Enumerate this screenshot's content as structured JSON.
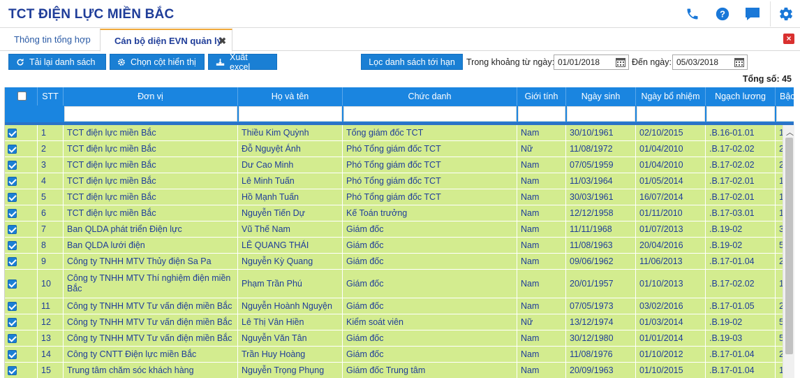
{
  "header": {
    "title": "TCT ĐIỆN LỰC MIỀN BẮC",
    "icons": [
      "phone-icon",
      "help-icon",
      "chat-icon",
      "settings-icon"
    ],
    "accent": "#1a78d8"
  },
  "tabs": [
    {
      "label": "Thông tin tổng hợp",
      "active": false
    },
    {
      "label": "Cán bộ diện EVN quản lý",
      "active": true,
      "close": "✖"
    }
  ],
  "toolbar": {
    "reload_label": "Tải lại danh sách",
    "columns_label": "Chọn cột hiển thị",
    "export_label": "Xuất excel",
    "filter_due_label": "Lọc danh sách tới hạn",
    "from_label": "Trong khoảng từ ngày:",
    "from_value": "01/01/2018",
    "to_label": "Đến ngày:",
    "to_value": "05/03/2018",
    "total_label": "Tổng số: 45"
  },
  "table": {
    "headers": [
      "",
      "STT",
      "Đơn vị",
      "Họ và tên",
      "Chức danh",
      "Giới tính",
      "Ngày sinh",
      "Ngày bổ nhiệm",
      "Ngạch lương",
      "Bậc"
    ],
    "rows": [
      {
        "stt": "1",
        "unit": "TCT điện lực miền Bắc",
        "name": "Thiều Kim Quỳnh",
        "title": "Tổng giám đốc TCT",
        "gender": "Nam",
        "dob": "30/10/1961",
        "appointed": "02/10/2015",
        "grade": ".B.16-01.01",
        "level": "1"
      },
      {
        "stt": "2",
        "unit": "TCT điện lực miền Bắc",
        "name": "Đỗ Nguyệt Ánh",
        "title": "Phó Tổng giám đốc TCT",
        "gender": "Nữ",
        "dob": "11/08/1972",
        "appointed": "01/04/2010",
        "grade": ".B.17-02.02",
        "level": "2"
      },
      {
        "stt": "3",
        "unit": "TCT điện lực miền Bắc",
        "name": "Dư Cao Minh",
        "title": "Phó Tổng giám đốc TCT",
        "gender": "Nam",
        "dob": "07/05/1959",
        "appointed": "01/04/2010",
        "grade": ".B.17-02.02",
        "level": "2"
      },
      {
        "stt": "4",
        "unit": "TCT điện lực miền Bắc",
        "name": "Lê Minh Tuấn",
        "title": "Phó Tổng giám đốc TCT",
        "gender": "Nam",
        "dob": "11/03/1964",
        "appointed": "01/05/2014",
        "grade": ".B.17-02.01",
        "level": "1"
      },
      {
        "stt": "5",
        "unit": "TCT điện lực miền Bắc",
        "name": "Hồ Mạnh Tuấn",
        "title": "Phó Tổng giám đốc TCT",
        "gender": "Nam",
        "dob": "30/03/1961",
        "appointed": "16/07/2014",
        "grade": ".B.17-02.01",
        "level": "1"
      },
      {
        "stt": "6",
        "unit": "TCT điện lực miền Bắc",
        "name": "Nguyễn Tiến Dự",
        "title": "Kế Toán trưởng",
        "gender": "Nam",
        "dob": "12/12/1958",
        "appointed": "01/11/2010",
        "grade": ".B.17-03.01",
        "level": "1"
      },
      {
        "stt": "7",
        "unit": "Ban QLDA phát triển Điện lực",
        "name": "Vũ Thế Nam",
        "title": "Giám đốc",
        "gender": "Nam",
        "dob": "11/11/1968",
        "appointed": "01/07/2013",
        "grade": ".B.19-02",
        "level": "3"
      },
      {
        "stt": "8",
        "unit": "Ban QLDA lưới điện",
        "name": "LÊ QUANG THÁI",
        "title": "Giám đốc",
        "gender": "Nam",
        "dob": "11/08/1963",
        "appointed": "20/04/2016",
        "grade": ".B.19-02",
        "level": "5"
      },
      {
        "stt": "9",
        "unit": "Công ty TNHH MTV Thủy điện Sa Pa",
        "name": "Nguyễn Kỳ Quang",
        "title": "Giám đốc",
        "gender": "Nam",
        "dob": "09/06/1962",
        "appointed": "11/06/2013",
        "grade": ".B.17-01.04",
        "level": "2"
      },
      {
        "stt": "10",
        "unit": "Công ty TNHH MTV Thí nghiệm điện miền Bắc",
        "name": "Phạm Trần Phú",
        "title": "Giám đốc",
        "gender": "Nam",
        "dob": "20/01/1957",
        "appointed": "01/10/2013",
        "grade": ".B.17-02.02",
        "level": "1"
      },
      {
        "stt": "11",
        "unit": "Công ty TNHH MTV Tư vấn điện miền Bắc",
        "name": "Nguyễn Hoành Nguyện",
        "title": "Giám đốc",
        "gender": "Nam",
        "dob": "07/05/1973",
        "appointed": "03/02/2016",
        "grade": ".B.17-01.05",
        "level": "2"
      },
      {
        "stt": "12",
        "unit": "Công ty TNHH MTV Tư vấn điện miền Bắc",
        "name": "Lê Thị Vân Hiền",
        "title": "Kiểm soát viên",
        "gender": "Nữ",
        "dob": "13/12/1974",
        "appointed": "01/03/2014",
        "grade": ".B.19-02",
        "level": "5"
      },
      {
        "stt": "13",
        "unit": "Công ty TNHH MTV Tư vấn điện miền Bắc",
        "name": "Nguyễn Văn Tân",
        "title": "Giám đốc",
        "gender": "Nam",
        "dob": "30/12/1980",
        "appointed": "01/01/2014",
        "grade": ".B.19-03",
        "level": "5"
      },
      {
        "stt": "14",
        "unit": "Công ty CNTT Điện lực miền Bắc",
        "name": "Trần Huy Hoàng",
        "title": "Giám đốc",
        "gender": "Nam",
        "dob": "11/08/1976",
        "appointed": "01/10/2012",
        "grade": ".B.17-01.04",
        "level": "2"
      },
      {
        "stt": "15",
        "unit": "Trung tâm chăm sóc khách hàng",
        "name": "Nguyễn Trọng Phụng",
        "title": "Giám đốc Trung tâm",
        "gender": "Nam",
        "dob": "20/09/1963",
        "appointed": "01/10/2015",
        "grade": ".B.17-01.04",
        "level": "1"
      }
    ],
    "row_color": "#d3ec8f",
    "header_color": "#1a85e0"
  }
}
